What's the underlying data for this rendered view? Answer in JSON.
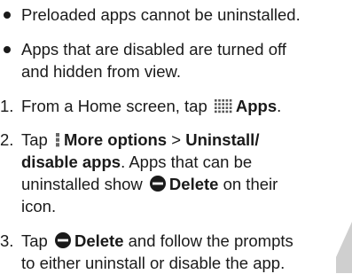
{
  "bullets": [
    {
      "lines": [
        [
          {
            "t": "Preloaded apps cannot be uninstalled."
          }
        ]
      ]
    },
    {
      "lines": [
        [
          {
            "t": "Apps that are disabled are turned off"
          }
        ],
        [
          {
            "t": "and hidden from view."
          }
        ]
      ]
    }
  ],
  "steps": [
    {
      "num": "1.",
      "lines": [
        [
          {
            "t": "From a Home screen, tap "
          },
          {
            "icon": "apps-grid-icon"
          },
          {
            "t": "Apps",
            "b": true
          },
          {
            "t": "."
          }
        ]
      ]
    },
    {
      "num": "2.",
      "lines": [
        [
          {
            "t": "Tap "
          },
          {
            "icon": "more-options-icon"
          },
          {
            "t": "More options",
            "b": true
          },
          {
            "t": " > "
          },
          {
            "t": "Uninstall/",
            "b": true
          }
        ],
        [
          {
            "t": "disable apps",
            "b": true
          },
          {
            "t": ". Apps that can be"
          }
        ],
        [
          {
            "t": "uninstalled show "
          },
          {
            "icon": "delete-icon"
          },
          {
            "t": "Delete",
            "b": true
          },
          {
            "t": " on their"
          }
        ],
        [
          {
            "t": "icon."
          }
        ]
      ]
    },
    {
      "num": "3.",
      "lines": [
        [
          {
            "t": "Tap "
          },
          {
            "icon": "delete-icon"
          },
          {
            "t": "Delete",
            "b": true
          },
          {
            "t": " and follow the prompts"
          }
        ],
        [
          {
            "t": "to either uninstall or disable the app."
          }
        ]
      ]
    }
  ],
  "colors": {
    "text": "#1a1a1a",
    "delete_icon": "#1a1a1a",
    "corner": "#cfcfcf"
  }
}
